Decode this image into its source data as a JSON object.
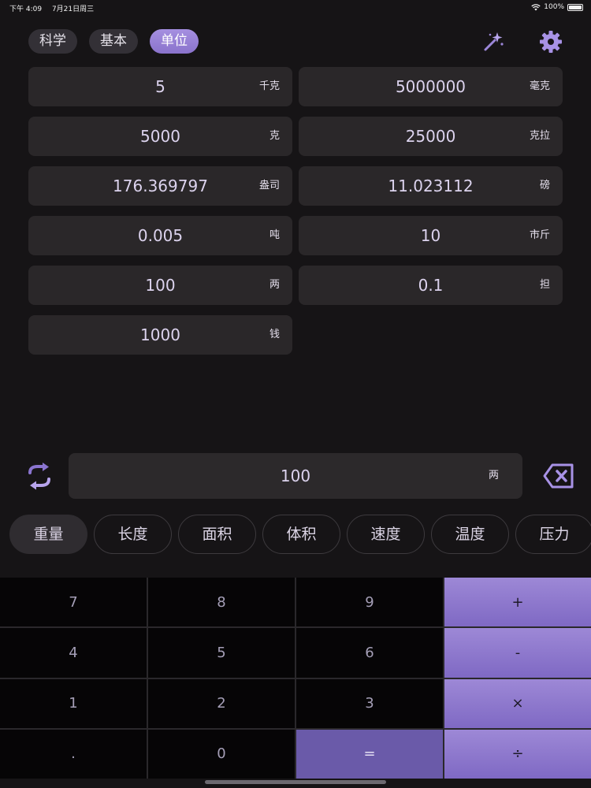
{
  "status": {
    "time": "下午 4:09",
    "date": "7月21日周三",
    "battery": "100%"
  },
  "mode_tabs": [
    {
      "label": "科学",
      "active": false
    },
    {
      "label": "基本",
      "active": false
    },
    {
      "label": "单位",
      "active": true
    }
  ],
  "icons": {
    "magic": "magic-wand-icon",
    "settings": "gear-icon",
    "swap": "swap-arrows-icon",
    "backspace": "backspace-icon"
  },
  "results": [
    {
      "value": "5",
      "unit": "千克"
    },
    {
      "value": "5000000",
      "unit": "毫克"
    },
    {
      "value": "5000",
      "unit": "克"
    },
    {
      "value": "25000",
      "unit": "克拉"
    },
    {
      "value": "176.369797",
      "unit": "盎司"
    },
    {
      "value": "11.023112",
      "unit": "磅"
    },
    {
      "value": "0.005",
      "unit": "吨"
    },
    {
      "value": "10",
      "unit": "市斤"
    },
    {
      "value": "100",
      "unit": "两"
    },
    {
      "value": "0.1",
      "unit": "担"
    },
    {
      "value": "1000",
      "unit": "钱"
    }
  ],
  "input": {
    "value": "100",
    "unit": "两"
  },
  "categories": [
    {
      "label": "重量",
      "active": true
    },
    {
      "label": "长度",
      "active": false
    },
    {
      "label": "面积",
      "active": false
    },
    {
      "label": "体积",
      "active": false
    },
    {
      "label": "速度",
      "active": false
    },
    {
      "label": "温度",
      "active": false
    },
    {
      "label": "压力",
      "active": false
    }
  ],
  "keypad": {
    "k7": "7",
    "k8": "8",
    "k9": "9",
    "plus": "+",
    "k4": "4",
    "k5": "5",
    "k6": "6",
    "minus": "-",
    "k1": "1",
    "k2": "2",
    "k3": "3",
    "times": "×",
    "dot": ".",
    "k0": "0",
    "equals": "=",
    "divide": "÷"
  },
  "colors": {
    "accent": "#8f78d0",
    "background": "#161416",
    "card": "#2a2729"
  }
}
